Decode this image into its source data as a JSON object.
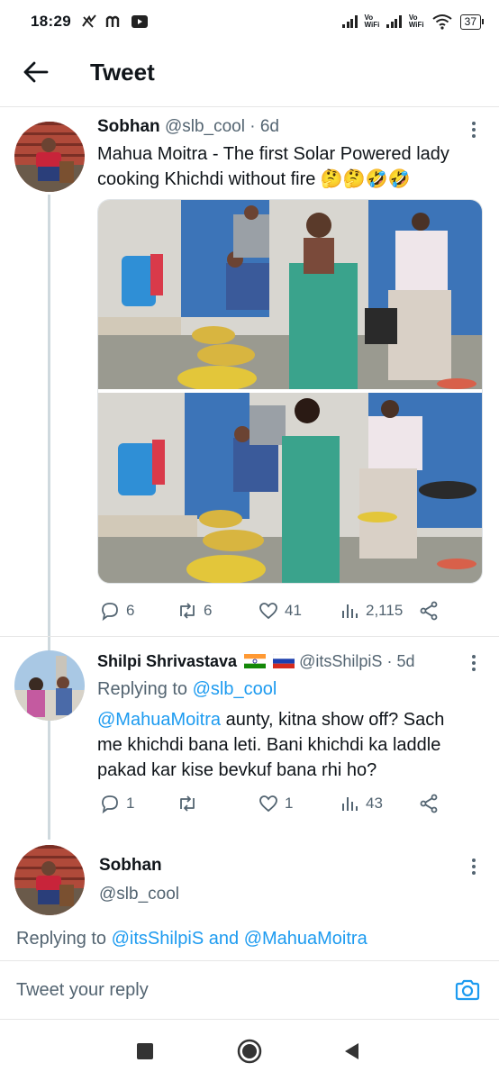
{
  "status_bar": {
    "time": "18:29",
    "left_icons": [
      "missed-call-icon",
      "m-app-icon",
      "youtube-icon"
    ],
    "signal_1_label": [
      "Vo",
      "WiFi"
    ],
    "signal_2_label": [
      "Vo",
      "WiFi"
    ],
    "battery": "37"
  },
  "header": {
    "title": "Tweet"
  },
  "tweet": {
    "name": "Sobhan",
    "handle": "@slb_cool",
    "age": "· 6d",
    "text_line1": "Mahua Moitra - The first Solar Powered lady",
    "text_line2": "cooking Khichdi without fire 🤔🤔🤣🤣",
    "stats": {
      "replies": "6",
      "retweets": "6",
      "likes": "41",
      "views": "2,115"
    }
  },
  "reply": {
    "name": "Shilpi Shrivastava",
    "handle": "@itsShilpiS",
    "age": "· 5d",
    "replying_prefix": "Replying to",
    "replying_to": "@slb_cool",
    "mention": "@MahuaMoitra",
    "text_line1_rest": " aunty, kitna show off? Sach",
    "text_line2": "me khichdi bana leti. Bani khichdi ka laddle",
    "text_line3": "pakad kar kise bevkuf bana rhi ho?",
    "stats": {
      "replies": "1",
      "retweets": "",
      "likes": "1",
      "views": "43"
    }
  },
  "composer": {
    "name": "Sobhan",
    "handle": "@slb_cool",
    "replying_prefix": "Replying to",
    "replying_user_1": "@itsShilpiS",
    "replying_and": "and",
    "replying_user_2": "@MahuaMoitra",
    "placeholder": "Tweet your reply"
  },
  "colors": {
    "accent": "#1d9bf0",
    "muted": "#536471",
    "line": "#cfd9de"
  }
}
